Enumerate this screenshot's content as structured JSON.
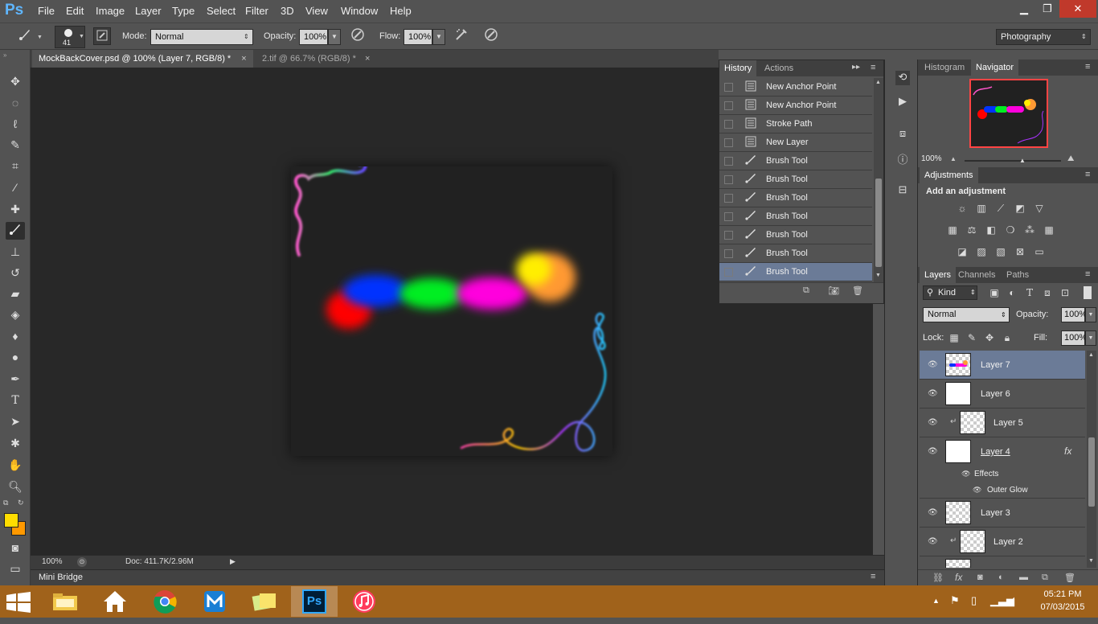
{
  "app": {
    "logo": "Ps"
  },
  "menu": [
    "File",
    "Edit",
    "Image",
    "Layer",
    "Type",
    "Select",
    "Filter",
    "3D",
    "View",
    "Window",
    "Help"
  ],
  "window_controls": {
    "minimize": "▁",
    "restore": "❐",
    "close": "✕"
  },
  "options_bar": {
    "brush_size": "41",
    "mode_label": "Mode:",
    "mode_value": "Normal",
    "opacity_label": "Opacity:",
    "opacity_value": "100%",
    "flow_label": "Flow:",
    "flow_value": "100%",
    "workspace": "Photography"
  },
  "document_tabs": [
    {
      "label": "MockBackCover.psd @ 100% (Layer 7, RGB/8) *",
      "close": "×",
      "active": true
    },
    {
      "label": "2.tif @ 66.7% (RGB/8) *",
      "close": "×",
      "active": false
    }
  ],
  "status_bar": {
    "zoom": "100%",
    "doc": "Doc: 411.7K/2.96M"
  },
  "mini_bridge": "Mini Bridge",
  "history_panel": {
    "tabs": [
      "History",
      "Actions"
    ],
    "items": [
      {
        "label": "New Anchor Point",
        "icon": "document-icon"
      },
      {
        "label": "New Anchor Point",
        "icon": "document-icon"
      },
      {
        "label": "Stroke Path",
        "icon": "document-icon"
      },
      {
        "label": "New Layer",
        "icon": "document-icon"
      },
      {
        "label": "Brush Tool",
        "icon": "brush-icon"
      },
      {
        "label": "Brush Tool",
        "icon": "brush-icon"
      },
      {
        "label": "Brush Tool",
        "icon": "brush-icon"
      },
      {
        "label": "Brush Tool",
        "icon": "brush-icon"
      },
      {
        "label": "Brush Tool",
        "icon": "brush-icon"
      },
      {
        "label": "Brush Tool",
        "icon": "brush-icon"
      },
      {
        "label": "Brush Tool",
        "icon": "brush-icon"
      }
    ]
  },
  "navigator_panel": {
    "tabs": [
      "Histogram",
      "Navigator"
    ],
    "zoom": "100%"
  },
  "adjustments_panel": {
    "title": "Adjustments",
    "subtitle": "Add an adjustment"
  },
  "layers_panel": {
    "tabs": [
      "Layers",
      "Channels",
      "Paths"
    ],
    "kind_filter": "Kind",
    "blend_mode": "Normal",
    "opacity_label": "Opacity:",
    "opacity_value": "100%",
    "lock_label": "Lock:",
    "fill_label": "Fill:",
    "fill_value": "100%",
    "layers": [
      {
        "name": "Layer 7",
        "selected": true
      },
      {
        "name": "Layer 6"
      },
      {
        "name": "Layer 5",
        "clipped": true
      },
      {
        "name": "Layer 4",
        "fx": "fx",
        "effects_label": "Effects",
        "effect": "Outer Glow"
      },
      {
        "name": "Layer 3"
      },
      {
        "name": "Layer 2",
        "clipped": true
      }
    ]
  },
  "taskbar": {
    "time": "05:21 PM",
    "date": "07/03/2015",
    "apps": [
      "file-explorer",
      "internet-explorer-home",
      "chrome",
      "maxthon",
      "sticky-notes",
      "photoshop",
      "itunes"
    ],
    "ps_label": "Ps"
  },
  "colors": {
    "foreground": "#ffdd00",
    "background": "#ff9900",
    "selection": "#6b7b97",
    "taskbar": "#a0621b"
  }
}
